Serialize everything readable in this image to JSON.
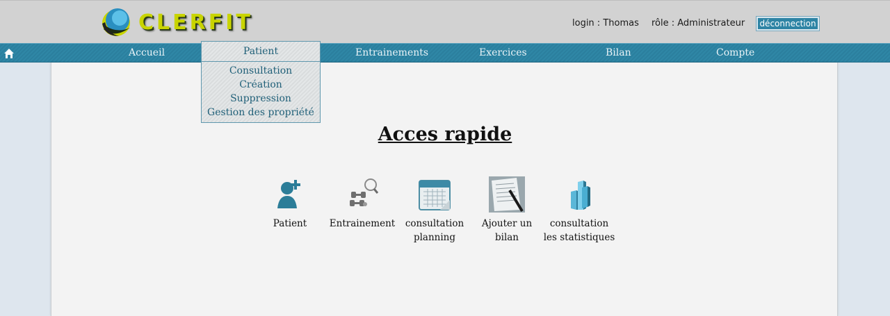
{
  "header": {
    "logo_text": "CLERFIT",
    "login_label": "login : Thomas",
    "role_label": "rôle : Administrateur",
    "logout_label": "déconnection"
  },
  "nav": {
    "items": [
      {
        "label": "Accueil"
      },
      {
        "label": "Patient"
      },
      {
        "label": "Entrainements"
      },
      {
        "label": "Exercices"
      },
      {
        "label": "Bilan"
      },
      {
        "label": "Compte"
      }
    ]
  },
  "dropdown": {
    "items": [
      {
        "label": "Consultation"
      },
      {
        "label": "Création"
      },
      {
        "label": "Suppression"
      },
      {
        "label": "Gestion des propriété"
      }
    ]
  },
  "main": {
    "title": "Acces rapide",
    "quick_access": [
      {
        "label": "Patient",
        "icon": "add-patient-icon"
      },
      {
        "label": "Entrainement",
        "icon": "dumbbells-icon"
      },
      {
        "label": "consultation planning",
        "icon": "calendar-icon"
      },
      {
        "label": "Ajouter un bilan",
        "icon": "document-pen-icon"
      },
      {
        "label": "consultation les statistiques",
        "icon": "bar-chart-icon"
      }
    ]
  },
  "colors": {
    "nav_bar": "#2f87a6",
    "header_bg": "#d2d2d2",
    "page_bg": "#dee6ee",
    "content_bg": "#f3f3f3",
    "logout_button": "#2e84a5",
    "logo_text": "#c8d400"
  }
}
